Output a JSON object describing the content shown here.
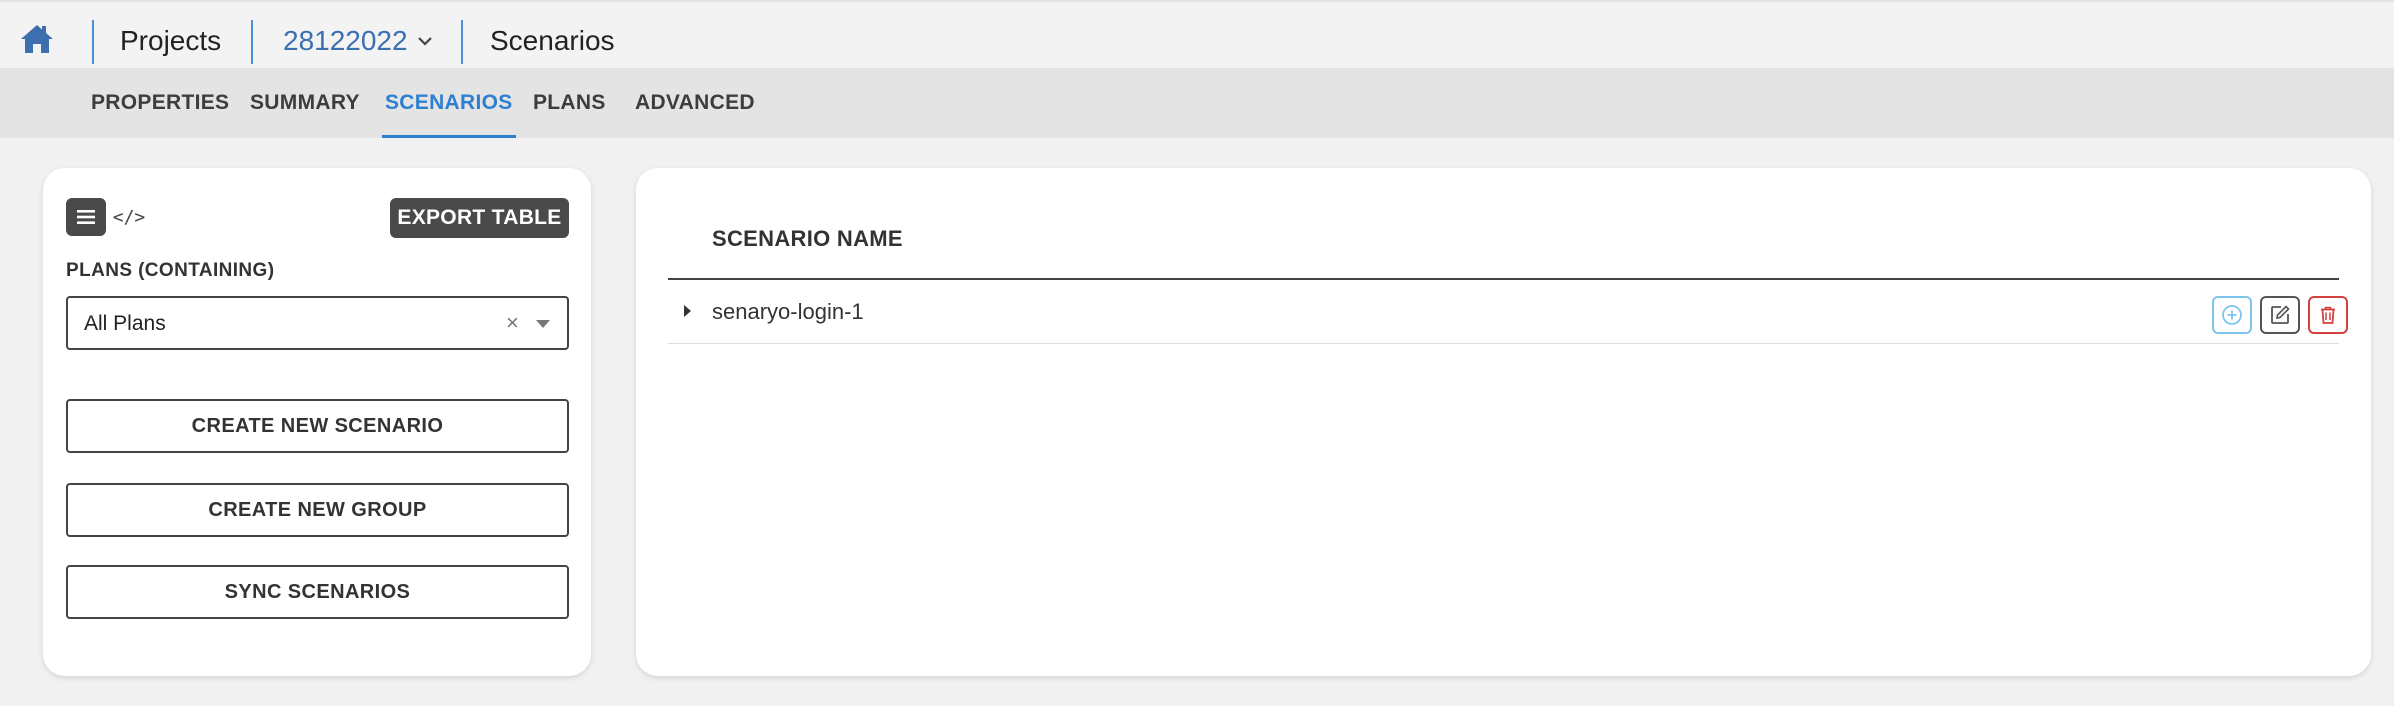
{
  "breadcrumb": {
    "home_icon": "home-icon",
    "projects_label": "Projects",
    "project_id": "28122022",
    "current_page": "Scenarios"
  },
  "tabs": [
    {
      "label": "PROPERTIES",
      "active": false
    },
    {
      "label": "SUMMARY",
      "active": false
    },
    {
      "label": "SCENARIOS",
      "active": true
    },
    {
      "label": "PLANS",
      "active": false
    },
    {
      "label": "ADVANCED",
      "active": false
    }
  ],
  "left_panel": {
    "menu_icon": "hamburger-menu-icon",
    "code_icon": "code-icon",
    "code_glyph": "</>",
    "export_label": "EXPORT TABLE",
    "filter_label": "PLANS (CONTAINING)",
    "filter_value": "All Plans",
    "clear_glyph": "×",
    "create_scenario_label": "CREATE NEW SCENARIO",
    "create_group_label": "CREATE NEW GROUP",
    "sync_label": "SYNC SCENARIOS"
  },
  "table": {
    "column_header": "SCENARIO NAME",
    "rows": [
      {
        "name": "senaryo-login-1"
      }
    ]
  },
  "colors": {
    "accent": "#2f7fd1",
    "link": "#3a6fb0",
    "add_action": "#7ec3ea",
    "delete_action": "#d24040",
    "dark_button": "#4a4a4a"
  }
}
